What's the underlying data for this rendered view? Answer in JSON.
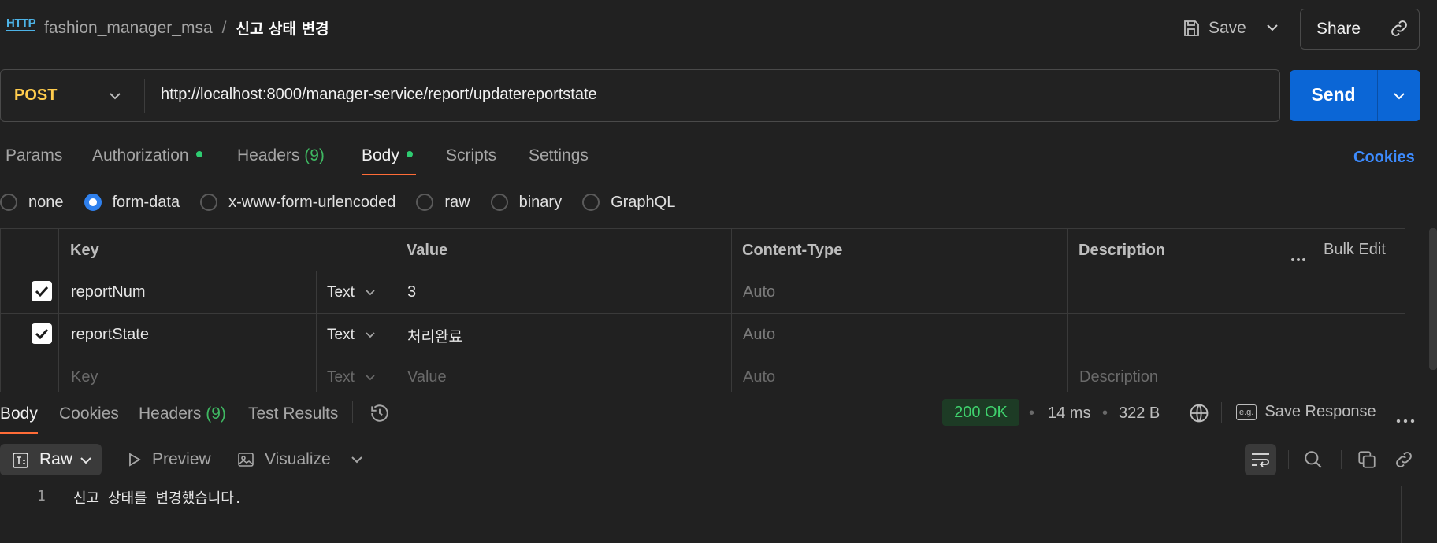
{
  "header": {
    "icon": "http-icon",
    "icon_label": "HTTP",
    "collection": "fashion_manager_msa",
    "separator": "/",
    "request_name": "신고 상태 변경",
    "save_label": "Save",
    "share_label": "Share"
  },
  "request": {
    "method": "POST",
    "url": "http://localhost:8000/manager-service/report/updatereportstate",
    "send_label": "Send"
  },
  "tabs": [
    {
      "label": "Params"
    },
    {
      "label": "Authorization"
    },
    {
      "label": "Headers",
      "count": "(9)"
    },
    {
      "label": "Body"
    },
    {
      "label": "Scripts"
    },
    {
      "label": "Settings"
    }
  ],
  "active_tab": "Body",
  "cookies_label": "Cookies",
  "body_types": [
    "none",
    "form-data",
    "x-www-form-urlencoded",
    "raw",
    "binary",
    "GraphQL"
  ],
  "selected_body_type": "form-data",
  "table": {
    "headers": {
      "key": "Key",
      "value": "Value",
      "content_type": "Content-Type",
      "description": "Description",
      "bulk_edit": "Bulk Edit"
    },
    "rows": [
      {
        "checked": true,
        "key": "reportNum",
        "type": "Text",
        "value": "3",
        "content_type": "Auto",
        "description": ""
      },
      {
        "checked": true,
        "key": "reportState",
        "type": "Text",
        "value": "처리완료",
        "content_type": "Auto",
        "description": ""
      }
    ],
    "placeholder": {
      "key": "Key",
      "type": "Text",
      "value": "Value",
      "content_type": "Auto",
      "description": "Description"
    }
  },
  "response": {
    "tabs": [
      {
        "label": "Body"
      },
      {
        "label": "Cookies"
      },
      {
        "label": "Headers",
        "count": "(9)"
      },
      {
        "label": "Test Results"
      }
    ],
    "status": "200 OK",
    "time": "14 ms",
    "size": "322 B",
    "save_response_label": "Save Response",
    "format": "Raw",
    "preview_label": "Preview",
    "visualize_label": "Visualize",
    "lines": [
      {
        "number": "1",
        "text": "신고 상태를 변경했습니다."
      }
    ]
  },
  "colors": {
    "accent_send": "#0b66d6",
    "method": "#ffcc4d",
    "active_underline": "#ff6c37",
    "status_ok": "#3fd16d"
  }
}
